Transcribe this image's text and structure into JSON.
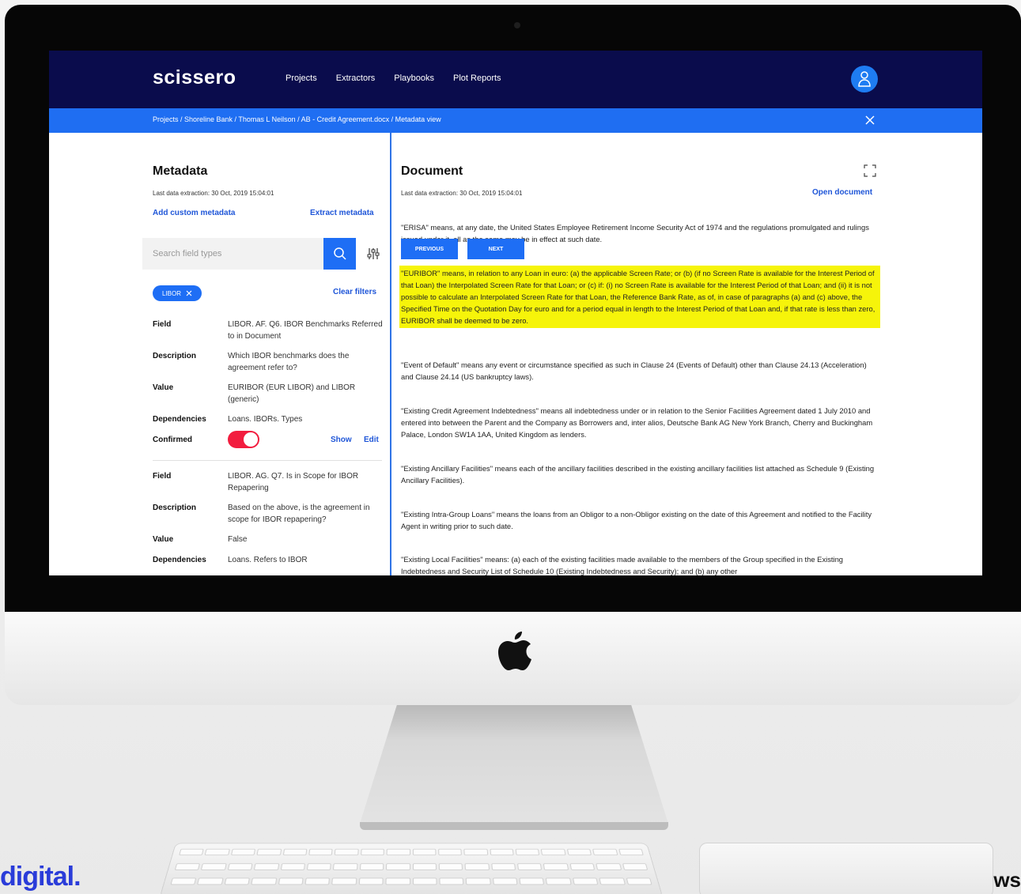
{
  "app": {
    "logo": "scissero",
    "nav": [
      "Projects",
      "Extractors",
      "Playbooks",
      "Plot Reports"
    ],
    "breadcrumb": "Projects / Shoreline Bank / Thomas L Neilson / AB - Credit Agreement.docx / Metadata view"
  },
  "metadata": {
    "title": "Metadata",
    "last_extraction": "Last data extraction: 30 Oct, 2019 15:04:01",
    "add_custom": "Add custom metadata",
    "extract": "Extract metadata",
    "search_placeholder": "Search field types",
    "chip": "LIBOR",
    "clear_filters": "Clear filters",
    "labels": {
      "field": "Field",
      "description": "Description",
      "value": "Value",
      "dependencies": "Dependencies",
      "confirmed": "Confirmed"
    },
    "show": "Show",
    "edit": "Edit",
    "items": [
      {
        "field": "LIBOR. AF. Q6. IBOR Benchmarks Referred to in Document",
        "description": "Which IBOR benchmarks does the agreement refer to?",
        "value": "EURIBOR (EUR LIBOR) and LIBOR (generic)",
        "dependencies": "Loans. IBORs. Types",
        "confirmed": true
      },
      {
        "field": "LIBOR. AG. Q7. Is in Scope for IBOR Repapering",
        "description": "Based on the above, is the agreement in scope for IBOR repapering?",
        "value": "False",
        "dependencies": "Loans. Refers to IBOR"
      }
    ]
  },
  "document": {
    "title": "Document",
    "last_extraction": "Last data extraction: 30 Oct, 2019 15:04:01",
    "open": "Open document",
    "previous": "PREVIOUS",
    "next": "NEXT",
    "paragraphs": [
      "\"ERISA\" means, at any date, the United States Employee Retirement Income Security Act of 1974 and the regulations promulgated and rulings issued under it, all as the same may be in effect at such date.",
      "\"EURIBOR\" means, in relation to any Loan in euro: (a) the applicable Screen Rate; or (b) (if no Screen Rate is available for the Interest Period of that Loan) the Interpolated Screen Rate for that Loan; or (c) if: (i) no Screen Rate is available for the Interest Period of that Loan; and (ii) it is not possible to calculate an Interpolated Screen Rate for that Loan, the Reference Bank Rate, as of, in case of paragraphs (a) and (c) above, the Specified Time on the Quotation Day for euro and for a period equal in length to the Interest Period of that Loan and, if that rate is less than zero, EURIBOR shall be deemed to be zero.",
      "\"Event of Default\" means any event or circumstance specified as such in Clause 24 (Events of Default) other than Clause 24.13 (Acceleration) and Clause 24.14 (US bankruptcy laws).",
      "\"Existing Credit Agreement Indebtedness\" means all indebtedness under or in relation to the Senior Facilities Agreement dated 1 July 2010 and entered into between the Parent and the Company as Borrowers and, inter alios, Deutsche Bank AG New York Branch, Cherry and Buckingham Palace, London SW1A 1AA, United Kingdom as lenders.",
      "\"Existing Ancillary Facilities\" means each of the ancillary facilities described in the existing ancillary facilities list attached as Schedule 9 (Existing Ancillary Facilities).",
      "\"Existing Intra-Group Loans\" means the loans from an Obligor to a non-Obligor existing on the date of this Agreement and notified to the Facility Agent in writing prior to such date.",
      "\"Existing Local Facilities\" means: (a) each of the existing facilities made available to the members of the Group specified in the Existing Indebtedness and Security List of Schedule 10 (Existing Indebtedness and Security); and (b) any other"
    ]
  },
  "branding": {
    "left": "digital.",
    "right": "ws"
  },
  "colors": {
    "nav_bg": "#0a0c4c",
    "accent": "#1e6ef5",
    "highlight": "#f6f40a",
    "toggle_on": "#f21d3f"
  }
}
